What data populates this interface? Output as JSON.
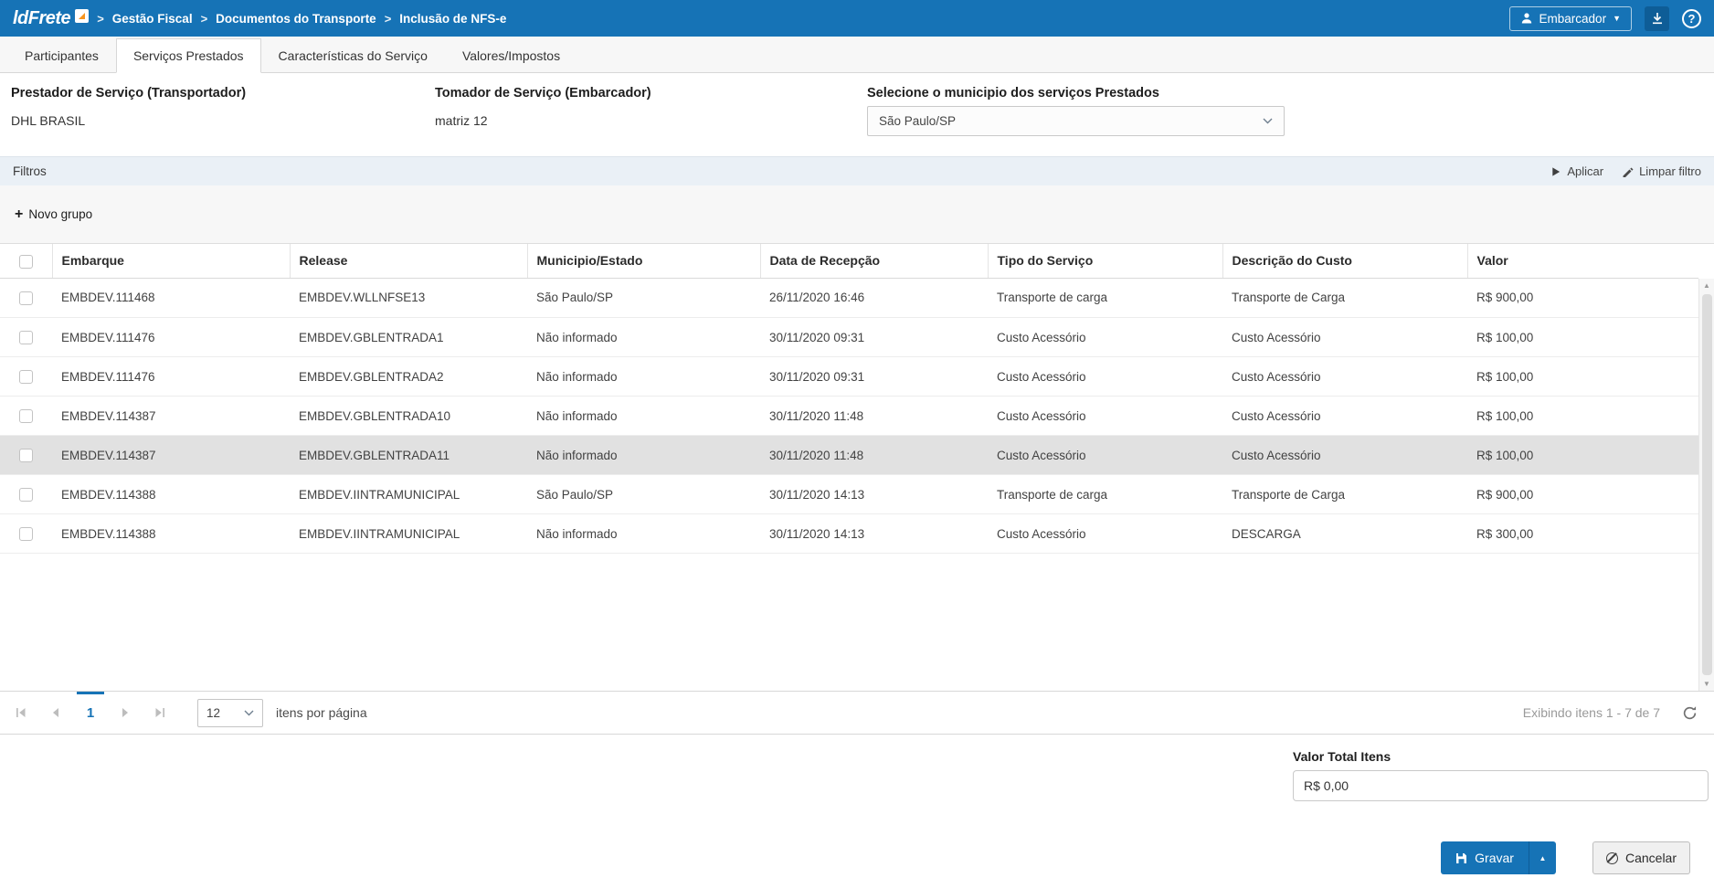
{
  "colors": {
    "accent": "#1673b6",
    "accent_dark": "#0e5d97",
    "filters_bg": "#eaf0f6",
    "highlight_row": "#e1e1e1"
  },
  "topbar": {
    "logo_text": "ldFrete",
    "breadcrumb": [
      "Gestão Fiscal",
      "Documentos do Transporte",
      "Inclusão de NFS-e"
    ],
    "user_label": "Embarcador"
  },
  "tabs": [
    "Participantes",
    "Serviços Prestados",
    "Características do Serviço",
    "Valores/Impostos"
  ],
  "form": {
    "prestador_label": "Prestador de Serviço (Transportador)",
    "prestador_value": "DHL BRASIL",
    "tomador_label": "Tomador de Serviço (Embarcador)",
    "tomador_value": "matriz 12",
    "municipio_label": "Selecione o municipio dos serviços Prestados",
    "municipio_value": "São Paulo/SP"
  },
  "filters": {
    "title": "Filtros",
    "apply_label": "Aplicar",
    "clear_label": "Limpar filtro",
    "new_group_label": "Novo grupo"
  },
  "table": {
    "headers": [
      "Embarque",
      "Release",
      "Municipio/Estado",
      "Data de Recepção",
      "Tipo do Serviço",
      "Descrição do Custo",
      "Valor"
    ],
    "highlight_row_index": 4,
    "rows": [
      {
        "embarque": "EMBDEV.111468",
        "release": "EMBDEV.WLLNFSE13",
        "municipio_estado": "São Paulo/SP",
        "data_recepcao": "26/11/2020 16:46",
        "tipo_servico": "Transporte de carga",
        "descricao_custo": "Transporte de Carga",
        "valor": "R$ 900,00"
      },
      {
        "embarque": "EMBDEV.111476",
        "release": "EMBDEV.GBLENTRADA1",
        "municipio_estado": "Não informado",
        "data_recepcao": "30/11/2020 09:31",
        "tipo_servico": "Custo Acessório",
        "descricao_custo": "Custo Acessório",
        "valor": "R$ 100,00"
      },
      {
        "embarque": "EMBDEV.111476",
        "release": "EMBDEV.GBLENTRADA2",
        "municipio_estado": "Não informado",
        "data_recepcao": "30/11/2020 09:31",
        "tipo_servico": "Custo Acessório",
        "descricao_custo": "Custo Acessório",
        "valor": "R$ 100,00"
      },
      {
        "embarque": "EMBDEV.114387",
        "release": "EMBDEV.GBLENTRADA10",
        "municipio_estado": "Não informado",
        "data_recepcao": "30/11/2020 11:48",
        "tipo_servico": "Custo Acessório",
        "descricao_custo": "Custo Acessório",
        "valor": "R$ 100,00"
      },
      {
        "embarque": "EMBDEV.114387",
        "release": "EMBDEV.GBLENTRADA11",
        "municipio_estado": "Não informado",
        "data_recepcao": "30/11/2020 11:48",
        "tipo_servico": "Custo Acessório",
        "descricao_custo": "Custo Acessório",
        "valor": "R$ 100,00"
      },
      {
        "embarque": "EMBDEV.114388",
        "release": "EMBDEV.IINTRAMUNICIPAL",
        "municipio_estado": "São Paulo/SP",
        "data_recepcao": "30/11/2020 14:13",
        "tipo_servico": "Transporte de carga",
        "descricao_custo": "Transporte de Carga",
        "valor": "R$ 900,00"
      },
      {
        "embarque": "EMBDEV.114388",
        "release": "EMBDEV.IINTRAMUNICIPAL",
        "municipio_estado": "Não informado",
        "data_recepcao": "30/11/2020 14:13",
        "tipo_servico": "Custo Acessório",
        "descricao_custo": "DESCARGA",
        "valor": "R$ 300,00"
      }
    ]
  },
  "pagination": {
    "page": "1",
    "page_size": "12",
    "per_page_label": "itens por página",
    "status": "Exibindo itens 1 - 7 de 7"
  },
  "footer": {
    "total_label": "Valor Total Itens",
    "total_value": "R$ 0,00",
    "save_label": "Gravar",
    "cancel_label": "Cancelar"
  }
}
